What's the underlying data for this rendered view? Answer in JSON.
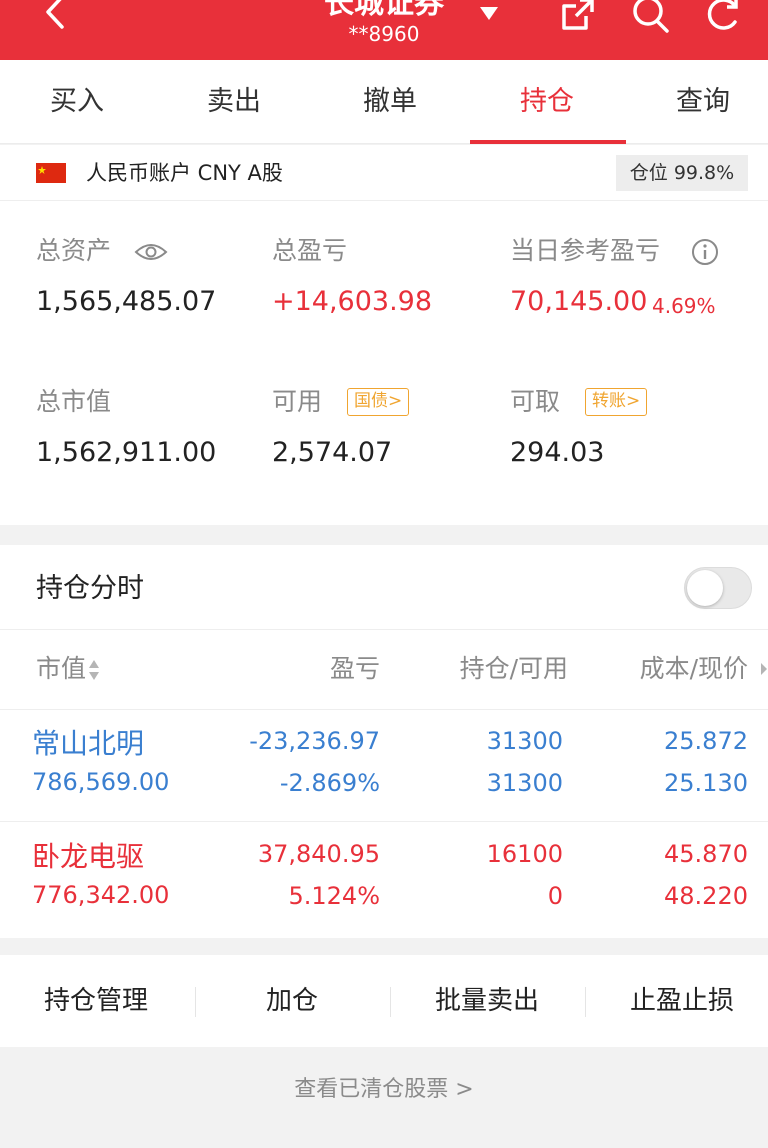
{
  "header": {
    "title": "长城证券",
    "account_masked": "**8960",
    "bg_color": "#e8303a"
  },
  "tabs": [
    {
      "label": "买入"
    },
    {
      "label": "卖出"
    },
    {
      "label": "撤单"
    },
    {
      "label": "持仓",
      "active": true
    },
    {
      "label": "查询"
    }
  ],
  "account": {
    "currency_label": "人民币账户 CNY A股",
    "position_ratio": "仓位 99.8%"
  },
  "metrics": {
    "total_assets_label": "总资产",
    "total_assets": "1,565,485.07",
    "total_pnl_label": "总盈亏",
    "total_pnl": "+14,603.98",
    "daily_pnl_label": "当日参考盈亏",
    "daily_pnl": "70,145.00",
    "daily_pnl_pct": "4.69%",
    "market_value_label": "总市值",
    "market_value": "1,562,911.00",
    "available_label": "可用",
    "available": "2,574.07",
    "treasury_tag": "国债>",
    "withdrawable_label": "可取",
    "withdrawable": "294.03",
    "transfer_tag": "转账>"
  },
  "holdings": {
    "section_title": "持仓分时",
    "toggle_on": false,
    "columns": {
      "market_value": "市值",
      "pnl": "盈亏",
      "position": "持仓/可用",
      "cost_price": "成本/现价"
    },
    "rows": [
      {
        "name": "常山北明",
        "market_value": "786,569.00",
        "pnl": "-23,236.97",
        "pnl_pct": "-2.869%",
        "position": "31300",
        "available": "31300",
        "cost": "25.872",
        "price": "25.130",
        "color": "#3a7fd0"
      },
      {
        "name": "卧龙电驱",
        "market_value": "776,342.00",
        "pnl": "37,840.95",
        "pnl_pct": "5.124%",
        "position": "16100",
        "available": "0",
        "cost": "45.870",
        "price": "48.220",
        "color": "#e8303a"
      }
    ]
  },
  "actions": [
    {
      "label": "持仓管理"
    },
    {
      "label": "加仓"
    },
    {
      "label": "批量卖出"
    },
    {
      "label": "止盈止损"
    }
  ],
  "footer": {
    "cleared_link": "查看已清仓股票 >"
  }
}
